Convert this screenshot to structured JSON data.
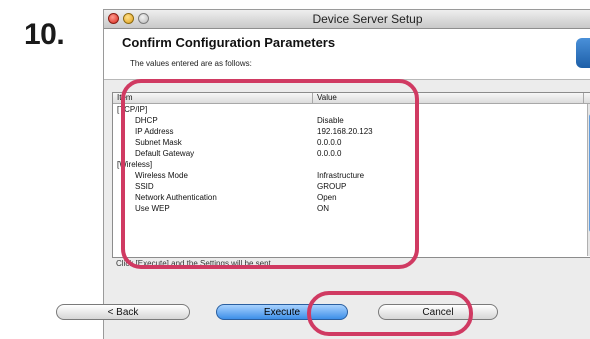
{
  "step_number": "10.",
  "window": {
    "title": "Device Server Setup"
  },
  "header": {
    "heading": "Confirm Configuration Parameters",
    "subheading": "The values entered are as follows:"
  },
  "table": {
    "columns": {
      "item": "Item",
      "value": "Value"
    },
    "rows": [
      {
        "item": "[TCP/IP]",
        "value": "",
        "indent": false
      },
      {
        "item": "DHCP",
        "value": "Disable",
        "indent": true
      },
      {
        "item": "IP Address",
        "value": "192.168.20.123",
        "indent": true
      },
      {
        "item": "Subnet Mask",
        "value": "0.0.0.0",
        "indent": true
      },
      {
        "item": "Default Gateway",
        "value": "0.0.0.0",
        "indent": true
      },
      {
        "item": "[Wireless]",
        "value": "",
        "indent": false
      },
      {
        "item": "Wireless Mode",
        "value": "Infrastructure",
        "indent": true
      },
      {
        "item": "SSID",
        "value": "GROUP",
        "indent": true
      },
      {
        "item": "Network Authentication",
        "value": "Open",
        "indent": true
      },
      {
        "item": "Use WEP",
        "value": "ON",
        "indent": true
      }
    ]
  },
  "info_text": "Click [Execute] and the Settings will be sent.",
  "buttons": {
    "back": "< Back",
    "execute": "Execute",
    "cancel": "Cancel"
  },
  "colors": {
    "highlight": "#d03a62",
    "execute_button": "#3d8fe8",
    "scroll_thumb": "#2a6fbf"
  }
}
